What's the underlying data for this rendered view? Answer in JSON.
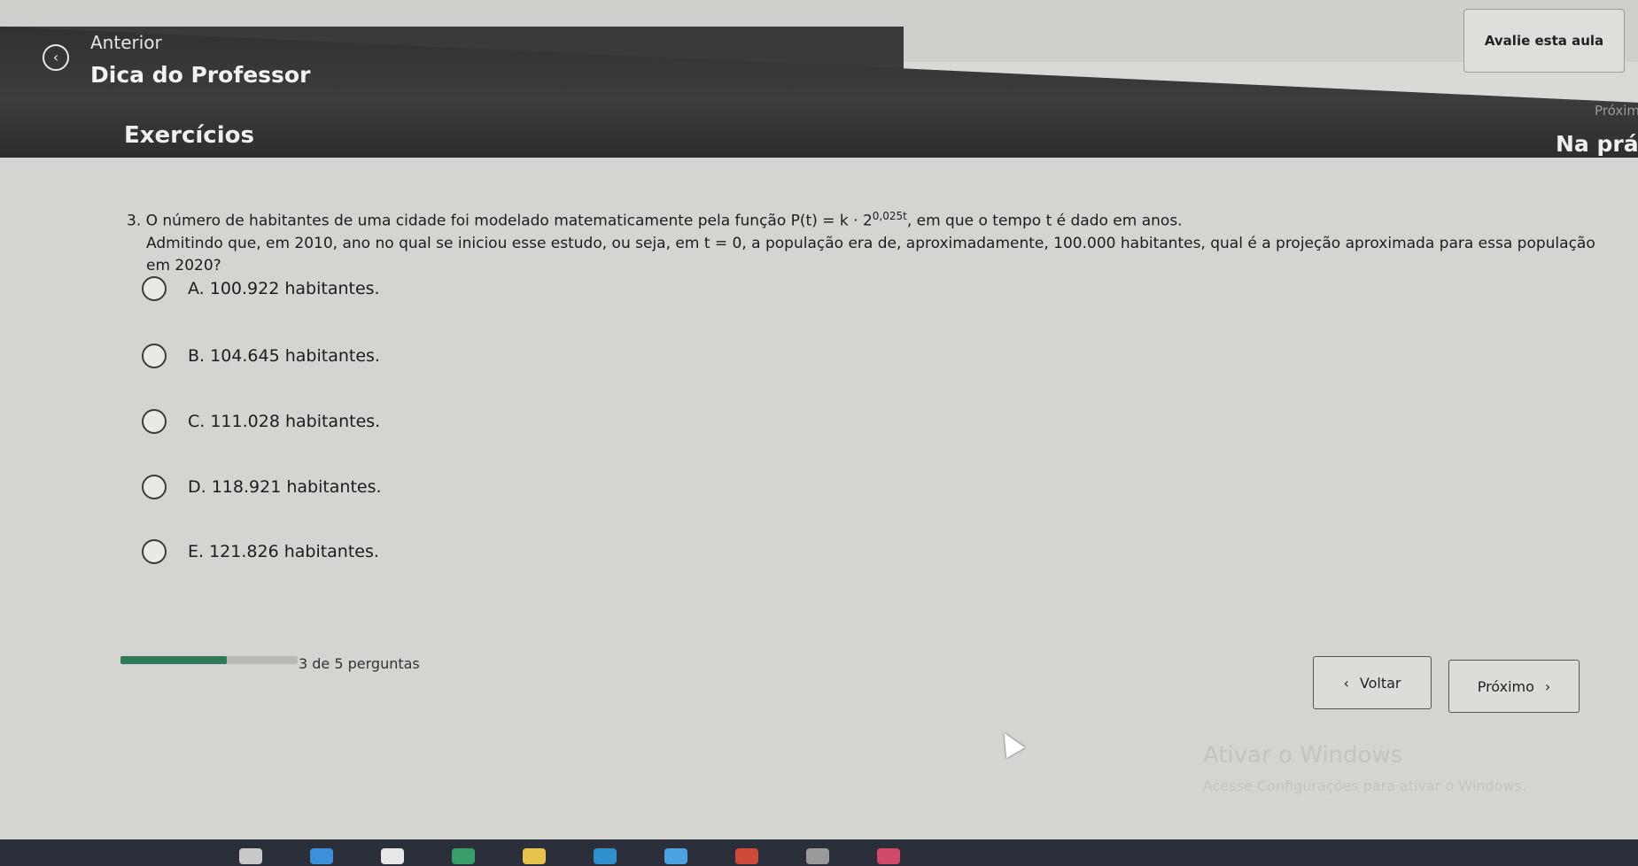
{
  "header": {
    "back_icon": "chevron-left-circle-icon",
    "previous_label": "Anterior",
    "section_title": "Dica do Professor",
    "page_title": "Exercícios",
    "next_small_label": "Próxim",
    "next_section_title": "Na prátic",
    "rate_button": "Avalie esta aula"
  },
  "question": {
    "intro": "3. O número de habitantes de uma cidade foi modelado matematicamente pela função ",
    "formula": "P(t) = k · 2",
    "exponent": "0,025t",
    "after_formula": ", em que o tempo t é dado em anos.",
    "line2": "Admitindo que, em 2010, ano no qual se iniciou esse estudo, ou seja, em t = 0, a população era de, aproximadamente, 100.000 habitantes, qual é a projeção aproximada para essa população em 2020?"
  },
  "options": [
    {
      "label": "A. 100.922 habitantes."
    },
    {
      "label": "B. 104.645 habitantes."
    },
    {
      "label": "C. 111.028 habitantes."
    },
    {
      "label": "D. 118.921 habitantes."
    },
    {
      "label": "E. 121.826 habitantes."
    }
  ],
  "progress": {
    "text": "3 de 5 perguntas",
    "fraction": 0.6
  },
  "navigation": {
    "back_label": "Voltar",
    "next_label": "Próximo"
  },
  "watermark": {
    "title": "Ativar o Windows",
    "subtitle": "Acesse Configurações para ativar o Windows."
  },
  "colors": {
    "progress_fill": "#2f7a56",
    "header_bg": "#383a3b"
  }
}
